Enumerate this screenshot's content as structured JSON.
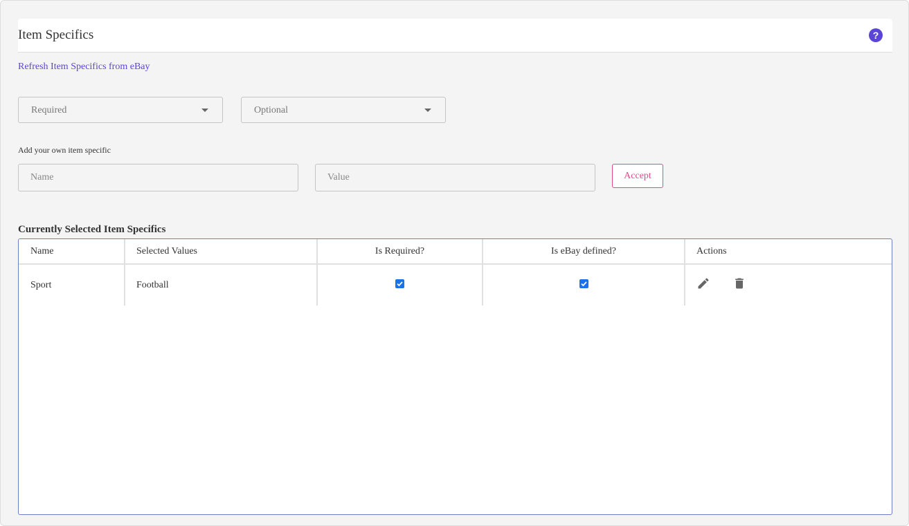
{
  "header": {
    "title": "Item Specifics",
    "help_icon": "help-circle-icon"
  },
  "refresh_link": "Refresh Item Specifics from eBay",
  "filters": {
    "required_label": "Required",
    "optional_label": "Optional"
  },
  "custom": {
    "label": "Add your own item specific",
    "name_placeholder": "Name",
    "value_placeholder": "Value",
    "accept_label": "Accept"
  },
  "table": {
    "title": "Currently Selected Item Specifics",
    "columns": [
      "Name",
      "Selected Values",
      "Is Required?",
      "Is eBay defined?",
      "Actions"
    ],
    "rows": [
      {
        "name": "Sport",
        "value": "Football",
        "is_required": true,
        "is_ebay_defined": true
      }
    ]
  },
  "colors": {
    "accent": "#5b45d6",
    "accept": "#e0498a",
    "checkbox": "#1a73e8",
    "table_border": "#6b7fc4"
  }
}
